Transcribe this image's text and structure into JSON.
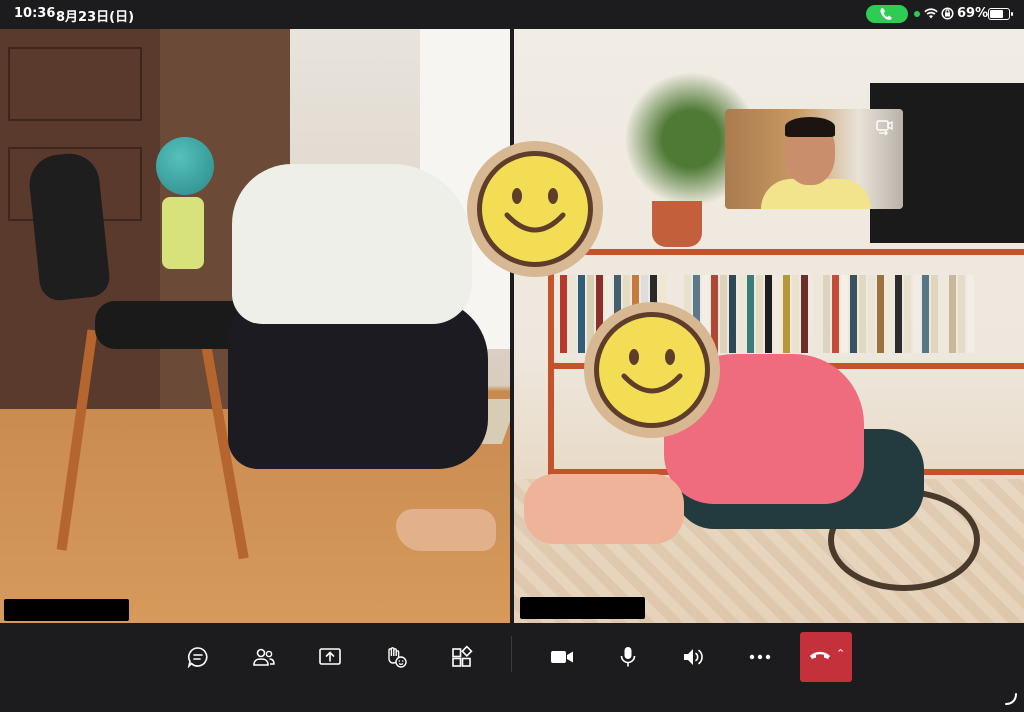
{
  "status_bar": {
    "time": "10:36",
    "date": "8月23日(日)",
    "battery": "69%",
    "call_indicator_color": "#2ecc55"
  },
  "participants": [
    {
      "name": ""
    },
    {
      "name": ""
    }
  ],
  "toolbar": {
    "chat": "chat-icon",
    "people": "people-icon",
    "share": "share-screen-icon",
    "reactions": "raise-hand-icon",
    "apps": "apps-icon",
    "camera": "camera-icon",
    "mic": "microphone-icon",
    "speaker": "speaker-icon",
    "more": "more-icon",
    "leave": "hang-up-icon",
    "leave_color": "#c4313b"
  },
  "colors": {
    "background": "#1c1c1e",
    "smiley_face": "#f2dd55",
    "smiley_outline": "#5e3d2a"
  }
}
